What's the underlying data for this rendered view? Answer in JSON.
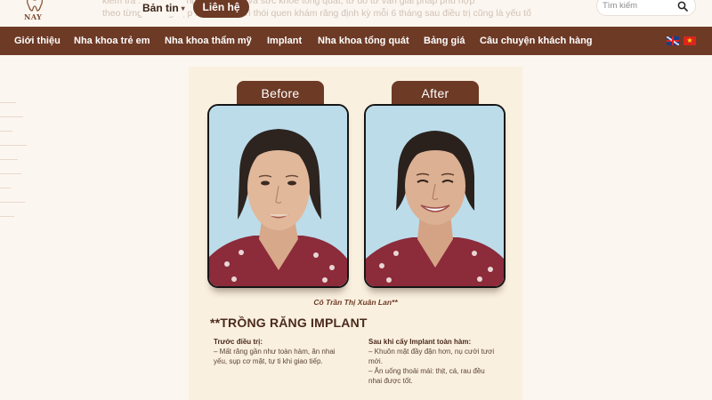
{
  "header": {
    "logo_text": "NAY",
    "bg_text": [
      "kiểm tra ... tăng xương hàm, nướu và sức khỏe tổng quát, từ đó tư vấn giải pháp phù hợp",
      "theo từng trường hợp ... việc duy trì thói quen khám răng định kỳ mỗi 6 tháng sau điều trị cũng là yếu tố"
    ],
    "news_label": "Bản tin",
    "contact_label": "Liên hệ",
    "search_placeholder": "Tìm kiếm"
  },
  "nav": {
    "items": [
      "Giới thiệu",
      "Nha khoa trẻ em",
      "Nha khoa thẩm mỹ",
      "Implant",
      "Nha khoa tổng quát",
      "Bảng giá",
      "Câu chuyện khách hàng"
    ]
  },
  "card": {
    "before_label": "Before",
    "after_label": "After",
    "caption": "Cô Trần Thị Xuân Lan**",
    "heading": "**TRỒNG RĂNG IMPLANT",
    "left": {
      "title": "Trước điều trị:",
      "lines": [
        "– Mất răng gần như toàn hàm, ăn nhai",
        "yếu, sụp cơ mặt, tự ti khi giao tiếp."
      ]
    },
    "right": {
      "title": "Sau khi cấy Implant toàn hàm:",
      "lines": [
        "– Khuôn mặt đầy đặn hơn, nụ cười tươi",
        "mới.",
        "– Ăn uống thoải mái: thịt, cá, rau đều",
        "nhai được tốt."
      ]
    }
  },
  "colors": {
    "brand": "#6d3a26",
    "page_bg": "#fcf6f0",
    "card_bg": "#faf0df",
    "photo_bg": "#b9dbe9"
  }
}
